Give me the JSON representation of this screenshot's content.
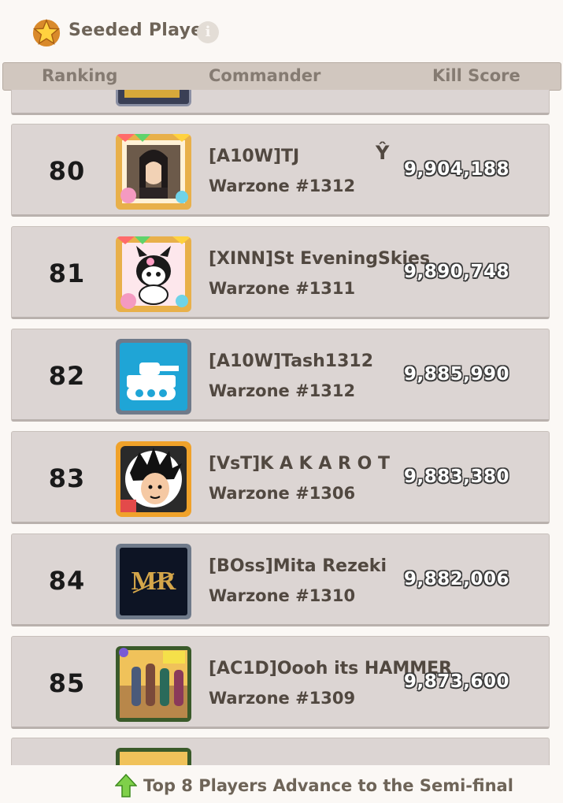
{
  "header": {
    "title": "Seeded Player",
    "info_icon": "i"
  },
  "columns": {
    "ranking": "Ranking",
    "commander": "Commander",
    "kill_score": "Kill Score"
  },
  "rows": [
    {
      "rank": "80",
      "name": "[A10W]TJ",
      "extra": "Ŷ",
      "warzone": "Warzone #1312",
      "score": "9,904,188",
      "avatar": "portrait-frame-icon"
    },
    {
      "rank": "81",
      "name": "[XINN]St EveningSkies",
      "warzone": "Warzone #1311",
      "score": "9,890,748",
      "avatar": "kuromi-frame-icon"
    },
    {
      "rank": "82",
      "name": "[A10W]Tash1312",
      "warzone": "Warzone #1312",
      "score": "9,885,990",
      "avatar": "tank-icon"
    },
    {
      "rank": "83",
      "name": "[VsT]K A K A R O T",
      "warzone": "Warzone #1306",
      "score": "9,883,380",
      "avatar": "goku-icon"
    },
    {
      "rank": "84",
      "name": "[BOss]Mita Rezeki",
      "warzone": "Warzone #1310",
      "score": "9,882,006",
      "avatar": "mr-logo-icon"
    },
    {
      "rank": "85",
      "name": "[AC1D]Oooh its HAMMER",
      "warzone": "Warzone #1309",
      "score": "9,873,600",
      "avatar": "hammer-time-icon"
    }
  ],
  "footer": {
    "text": "Top 8 Players Advance to the Semi-final",
    "icon": "green-up-arrow-icon"
  }
}
